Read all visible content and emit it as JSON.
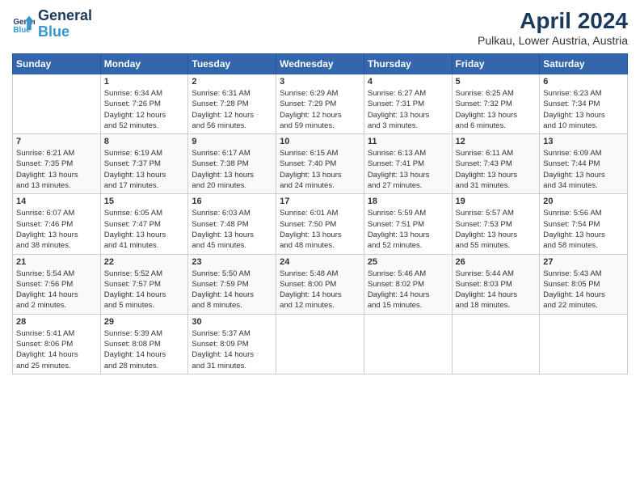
{
  "header": {
    "logo_line1": "General",
    "logo_line2": "Blue",
    "title": "April 2024",
    "subtitle": "Pulkau, Lower Austria, Austria"
  },
  "calendar": {
    "days_of_week": [
      "Sunday",
      "Monday",
      "Tuesday",
      "Wednesday",
      "Thursday",
      "Friday",
      "Saturday"
    ],
    "weeks": [
      [
        {
          "day": "",
          "content": ""
        },
        {
          "day": "1",
          "content": "Sunrise: 6:34 AM\nSunset: 7:26 PM\nDaylight: 12 hours\nand 52 minutes."
        },
        {
          "day": "2",
          "content": "Sunrise: 6:31 AM\nSunset: 7:28 PM\nDaylight: 12 hours\nand 56 minutes."
        },
        {
          "day": "3",
          "content": "Sunrise: 6:29 AM\nSunset: 7:29 PM\nDaylight: 12 hours\nand 59 minutes."
        },
        {
          "day": "4",
          "content": "Sunrise: 6:27 AM\nSunset: 7:31 PM\nDaylight: 13 hours\nand 3 minutes."
        },
        {
          "day": "5",
          "content": "Sunrise: 6:25 AM\nSunset: 7:32 PM\nDaylight: 13 hours\nand 6 minutes."
        },
        {
          "day": "6",
          "content": "Sunrise: 6:23 AM\nSunset: 7:34 PM\nDaylight: 13 hours\nand 10 minutes."
        }
      ],
      [
        {
          "day": "7",
          "content": "Sunrise: 6:21 AM\nSunset: 7:35 PM\nDaylight: 13 hours\nand 13 minutes."
        },
        {
          "day": "8",
          "content": "Sunrise: 6:19 AM\nSunset: 7:37 PM\nDaylight: 13 hours\nand 17 minutes."
        },
        {
          "day": "9",
          "content": "Sunrise: 6:17 AM\nSunset: 7:38 PM\nDaylight: 13 hours\nand 20 minutes."
        },
        {
          "day": "10",
          "content": "Sunrise: 6:15 AM\nSunset: 7:40 PM\nDaylight: 13 hours\nand 24 minutes."
        },
        {
          "day": "11",
          "content": "Sunrise: 6:13 AM\nSunset: 7:41 PM\nDaylight: 13 hours\nand 27 minutes."
        },
        {
          "day": "12",
          "content": "Sunrise: 6:11 AM\nSunset: 7:43 PM\nDaylight: 13 hours\nand 31 minutes."
        },
        {
          "day": "13",
          "content": "Sunrise: 6:09 AM\nSunset: 7:44 PM\nDaylight: 13 hours\nand 34 minutes."
        }
      ],
      [
        {
          "day": "14",
          "content": "Sunrise: 6:07 AM\nSunset: 7:46 PM\nDaylight: 13 hours\nand 38 minutes."
        },
        {
          "day": "15",
          "content": "Sunrise: 6:05 AM\nSunset: 7:47 PM\nDaylight: 13 hours\nand 41 minutes."
        },
        {
          "day": "16",
          "content": "Sunrise: 6:03 AM\nSunset: 7:48 PM\nDaylight: 13 hours\nand 45 minutes."
        },
        {
          "day": "17",
          "content": "Sunrise: 6:01 AM\nSunset: 7:50 PM\nDaylight: 13 hours\nand 48 minutes."
        },
        {
          "day": "18",
          "content": "Sunrise: 5:59 AM\nSunset: 7:51 PM\nDaylight: 13 hours\nand 52 minutes."
        },
        {
          "day": "19",
          "content": "Sunrise: 5:57 AM\nSunset: 7:53 PM\nDaylight: 13 hours\nand 55 minutes."
        },
        {
          "day": "20",
          "content": "Sunrise: 5:56 AM\nSunset: 7:54 PM\nDaylight: 13 hours\nand 58 minutes."
        }
      ],
      [
        {
          "day": "21",
          "content": "Sunrise: 5:54 AM\nSunset: 7:56 PM\nDaylight: 14 hours\nand 2 minutes."
        },
        {
          "day": "22",
          "content": "Sunrise: 5:52 AM\nSunset: 7:57 PM\nDaylight: 14 hours\nand 5 minutes."
        },
        {
          "day": "23",
          "content": "Sunrise: 5:50 AM\nSunset: 7:59 PM\nDaylight: 14 hours\nand 8 minutes."
        },
        {
          "day": "24",
          "content": "Sunrise: 5:48 AM\nSunset: 8:00 PM\nDaylight: 14 hours\nand 12 minutes."
        },
        {
          "day": "25",
          "content": "Sunrise: 5:46 AM\nSunset: 8:02 PM\nDaylight: 14 hours\nand 15 minutes."
        },
        {
          "day": "26",
          "content": "Sunrise: 5:44 AM\nSunset: 8:03 PM\nDaylight: 14 hours\nand 18 minutes."
        },
        {
          "day": "27",
          "content": "Sunrise: 5:43 AM\nSunset: 8:05 PM\nDaylight: 14 hours\nand 22 minutes."
        }
      ],
      [
        {
          "day": "28",
          "content": "Sunrise: 5:41 AM\nSunset: 8:06 PM\nDaylight: 14 hours\nand 25 minutes."
        },
        {
          "day": "29",
          "content": "Sunrise: 5:39 AM\nSunset: 8:08 PM\nDaylight: 14 hours\nand 28 minutes."
        },
        {
          "day": "30",
          "content": "Sunrise: 5:37 AM\nSunset: 8:09 PM\nDaylight: 14 hours\nand 31 minutes."
        },
        {
          "day": "",
          "content": ""
        },
        {
          "day": "",
          "content": ""
        },
        {
          "day": "",
          "content": ""
        },
        {
          "day": "",
          "content": ""
        }
      ]
    ]
  }
}
